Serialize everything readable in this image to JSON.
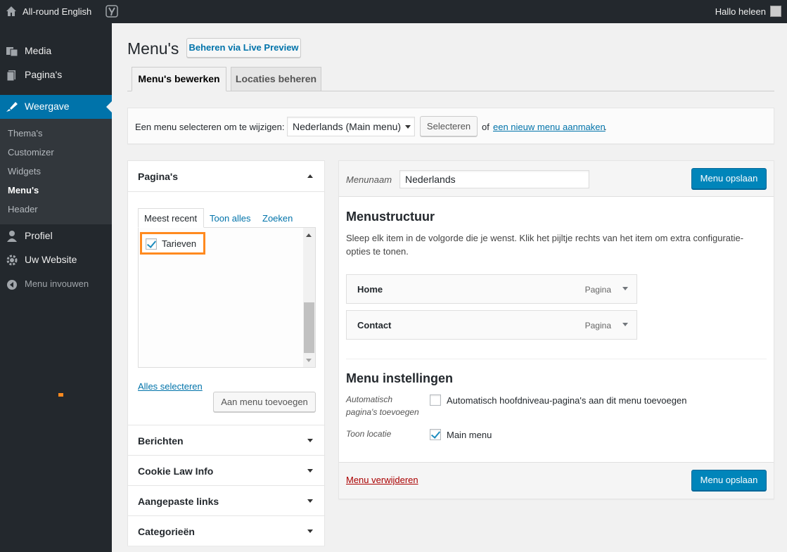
{
  "adminbar": {
    "site_name": "All-round English",
    "howdy": "Hallo heleen",
    "icons": [
      "home-icon",
      "yoast-icon",
      "avatar"
    ]
  },
  "sidebar": {
    "items": [
      {
        "label": "Media",
        "icon": "media-icon"
      },
      {
        "label": "Pagina's",
        "icon": "pages-icon"
      },
      {
        "label": "Weergave",
        "icon": "appearance-icon",
        "active": true
      },
      {
        "label": "Profiel",
        "icon": "user-icon"
      },
      {
        "label": "Uw Website",
        "icon": "settings-icon"
      },
      {
        "label": "Menu invouwen",
        "icon": "collapse-icon"
      }
    ],
    "submenu": [
      {
        "label": "Thema's"
      },
      {
        "label": "Customizer"
      },
      {
        "label": "Widgets"
      },
      {
        "label": "Menu's",
        "current": true
      },
      {
        "label": "Header"
      }
    ]
  },
  "page": {
    "title": "Menu's",
    "live_preview": "Beheren via Live Preview",
    "tabs": [
      "Menu's bewerken",
      "Locaties beheren"
    ]
  },
  "select_bar": {
    "label": "Een menu selecteren om te wijzigen:",
    "selected": "Nederlands (Main menu)",
    "button": "Selecteren",
    "or": "of",
    "create_link": "een nieuw menu aanmaken",
    "period": "."
  },
  "left_panel": {
    "pages_title": "Pagina's",
    "tabs": [
      "Meest recent",
      "Toon alles",
      "Zoeken"
    ],
    "pages": [
      {
        "label": "Tarieven",
        "checked": true
      }
    ],
    "select_all": "Alles selecteren",
    "add_button": "Aan menu toevoegen",
    "sections": [
      "Berichten",
      "Cookie Law Info",
      "Aangepaste links",
      "Categorieën"
    ]
  },
  "menu_panel": {
    "name_label": "Menunaam",
    "name_value": "Nederlands",
    "save": "Menu opslaan",
    "structure_title": "Menustructuur",
    "structure_desc_1": "Sleep elk item in de volgorde die je wenst. Klik het pijltje rechts van het item om extra configuratie-",
    "structure_desc_2": "opties te tonen.",
    "items": [
      {
        "label": "Home",
        "type": "Pagina"
      },
      {
        "label": "Contact",
        "type": "Pagina"
      }
    ],
    "settings_title": "Menu instellingen",
    "auto_label_1": "Automatisch",
    "auto_label_2": "pagina's toevoegen",
    "auto_option": "Automatisch hoofdniveau-pagina's aan dit menu toevoegen",
    "auto_checked": false,
    "location_label": "Toon locatie",
    "location_option": "Main menu",
    "location_checked": true,
    "delete": "Menu verwijderen"
  },
  "colors": {
    "admin_dark": "#23282d",
    "accent": "#0073aa",
    "primary_button": "#0085ba",
    "highlight": "#ff8a1f",
    "delete": "#a00"
  }
}
